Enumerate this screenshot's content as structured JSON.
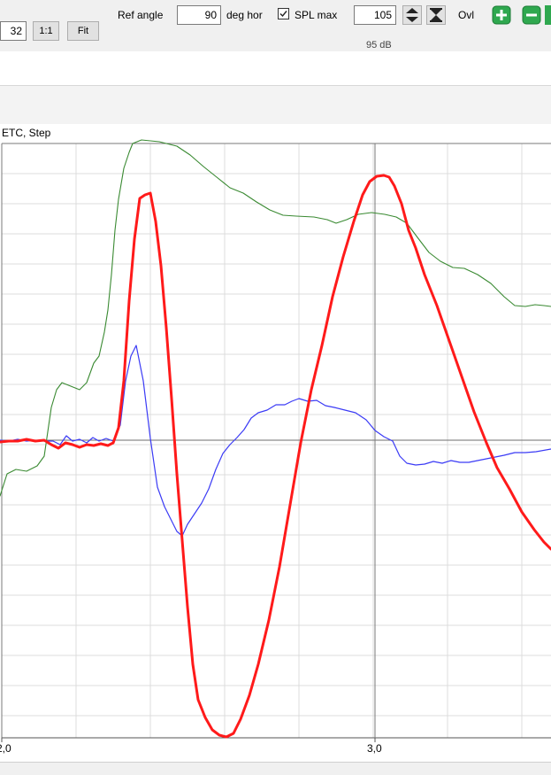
{
  "toolbar": {
    "zoom_value": "32",
    "btn_one_to_one": "1:1",
    "btn_fit": "Fit",
    "ref_angle_label": "Ref angle",
    "ref_angle_value": "90",
    "deg_hor_label": "deg hor",
    "spl_max_label": "SPL max",
    "spl_max_checked": true,
    "spl_max_value": "105",
    "ovl_label": "Ovl",
    "db_hint": "95 dB"
  },
  "plot": {
    "title": "ETC, Step",
    "x_tick_labels": [
      "2,0",
      "3,0"
    ]
  },
  "colors": {
    "red": "#ff1a1a",
    "blue": "#3b3bf5",
    "green": "#3a8a32",
    "grid": "#dcdcdc",
    "axis": "#7a7a7a",
    "ovl_green": "#2fa84f"
  }
}
